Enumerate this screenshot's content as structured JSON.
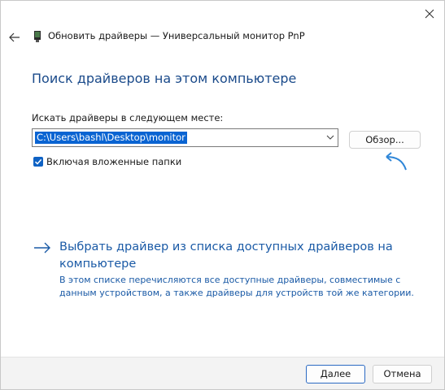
{
  "window": {
    "title": "Обновить драйверы — Универсальный монитор PnP",
    "close_icon": "close-icon",
    "back_icon": "back-arrow-icon",
    "device_icon": "monitor-device-icon"
  },
  "main": {
    "heading": "Поиск драйверов на этом компьютере",
    "path_label": "Искать драйверы в следующем месте:",
    "path_value": "C:\\Users\\bashl\\Desktop\\monitor",
    "browse_label": "Обзор...",
    "include_subfolders_label": "Включая вложенные папки",
    "include_subfolders_checked": true,
    "pick_link_title": "Выбрать драйвер из списка доступных драйверов на компьютере",
    "pick_link_desc": "В этом списке перечисляются все доступные драйверы, совместимые с данным устройством, а также драйверы для устройств той же категории."
  },
  "footer": {
    "next_label": "Далее",
    "cancel_label": "Отмена"
  },
  "colors": {
    "accent": "#0f62c4",
    "link": "#1a5aa6",
    "heading": "#1a4a8a",
    "selection": "#0a64d2"
  }
}
